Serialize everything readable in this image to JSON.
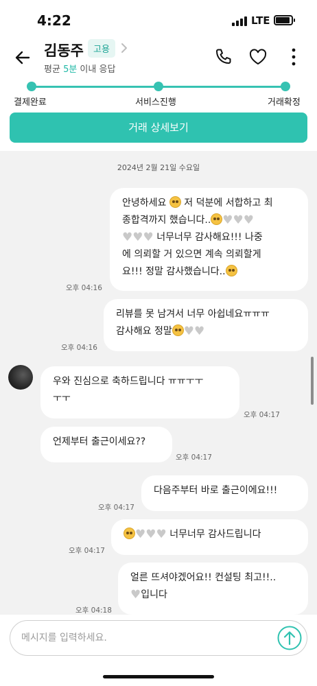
{
  "status_bar": {
    "time": "4:22",
    "network": "LTE",
    "battery_level": 0.85
  },
  "header": {
    "name": "김동주",
    "badge": "고용",
    "response_prefix": "평균 ",
    "response_highlight": "5분",
    "response_suffix": " 이내 응답",
    "icons": [
      "back-arrow-icon",
      "chevron-right-icon",
      "phone-icon",
      "heart-icon",
      "more-vertical-icon"
    ]
  },
  "progress": {
    "steps": [
      "결제완료",
      "서비스진행",
      "거래확정"
    ]
  },
  "detail_button": "거래 상세보기",
  "chat": {
    "date": "2024년 2월 21일 수요일",
    "messages": [
      {
        "side": "right",
        "lines": [
          "안녕하세요 [s] 저 덕분에 서합하고 최",
          "종합격까지 했습니다..[s][h][h][h]",
          "[h][h][h] 너무너무 감사해요!!! 나중",
          "에 의뢰할 거 있으면 계속 의뢰할게",
          "요!!! 정말 감사했습니다..[s]"
        ],
        "time": "오후 04:16"
      },
      {
        "side": "right",
        "lines": [
          "리뷰를 못 남겨서 너무 아쉽네요ㅠㅠㅠ",
          "감사해요 정말[s][h][h]"
        ],
        "time": "오후 04:16"
      },
      {
        "side": "left",
        "lines": [
          "우와 진심으로 축하드립니다 ㅠㅠㅜㅜ",
          "ㅜㅜ"
        ],
        "time": "오후 04:17"
      },
      {
        "side": "left",
        "lines": [
          "언제부터 출근이세요??"
        ],
        "time": "오후 04:17"
      },
      {
        "side": "right",
        "lines": [
          "다음주부터 바로 출근이에요!!!"
        ],
        "time": "오후 04:17"
      },
      {
        "side": "right",
        "lines": [
          "[s][h][h][h] 너무너무 감사드립니다"
        ],
        "time": "오후 04:17"
      },
      {
        "side": "right",
        "lines": [
          "얼른 뜨셔야겠어요!! 컨설팅 최고!!..",
          "[h]입니다"
        ],
        "time": "오후 04:18"
      }
    ],
    "emoji": {
      "s": "pleading-face-emoji",
      "h": "white-heart-emoji"
    }
  },
  "input": {
    "placeholder": "메시지를 입력하세요.",
    "value": ""
  },
  "colors": {
    "accent": "#2fc2b0",
    "badge_bg": "#e6f6f3",
    "badge_text": "#1fa596",
    "chat_bg": "#f2f2f2"
  }
}
